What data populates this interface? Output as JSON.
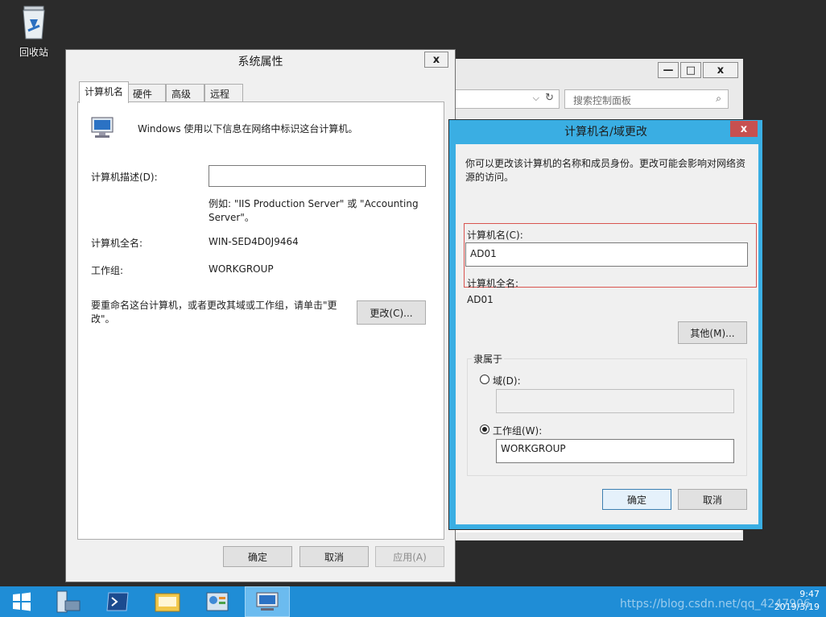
{
  "desktop": {
    "recycle_bin_label": "回收站"
  },
  "control_panel": {
    "search_placeholder": "搜索控制面板",
    "minimize": "—",
    "maximize": "□",
    "close": "x"
  },
  "system_properties": {
    "title": "系统属性",
    "close": "x",
    "tabs": [
      "计算机名",
      "硬件",
      "高级",
      "远程"
    ],
    "intro": "Windows 使用以下信息在网络中标识这台计算机。",
    "description_label": "计算机描述(D):",
    "description_value": "",
    "example_text": "例如: \"IIS Production Server\" 或 \"Accounting Server\"。",
    "full_name_label": "计算机全名:",
    "full_name_value": "WIN-SED4D0J9464",
    "workgroup_label": "工作组:",
    "workgroup_value": "WORKGROUP",
    "rename_hint": "要重命名这台计算机，或者更改其域或工作组，请单击\"更改\"。",
    "change_button": "更改(C)...",
    "ok_button": "确定",
    "cancel_button": "取消",
    "apply_button": "应用(A)"
  },
  "computer_name_dialog": {
    "title": "计算机名/域更改",
    "close": "x",
    "intro": "你可以更改该计算机的名称和成员身份。更改可能会影响对网络资源的访问。",
    "name_label": "计算机名(C):",
    "name_value": "AD01",
    "full_name_label": "计算机全名:",
    "full_name_value": "AD01",
    "more_button": "其他(M)...",
    "member_of_label": "隶属于",
    "domain_label": "域(D):",
    "domain_value": "",
    "workgroup_label": "工作组(W):",
    "workgroup_value": "WORKGROUP",
    "selected_membership": "workgroup",
    "ok_button": "确定",
    "cancel_button": "取消"
  },
  "taskbar": {
    "time": "9:47",
    "date": "2019/3/19"
  },
  "watermark": "https://blog.csdn.net/qq_4247906",
  "colors": {
    "accent": "#3aaee3",
    "taskbar": "#1f8dd6",
    "highlight_box": "#d9534f"
  }
}
